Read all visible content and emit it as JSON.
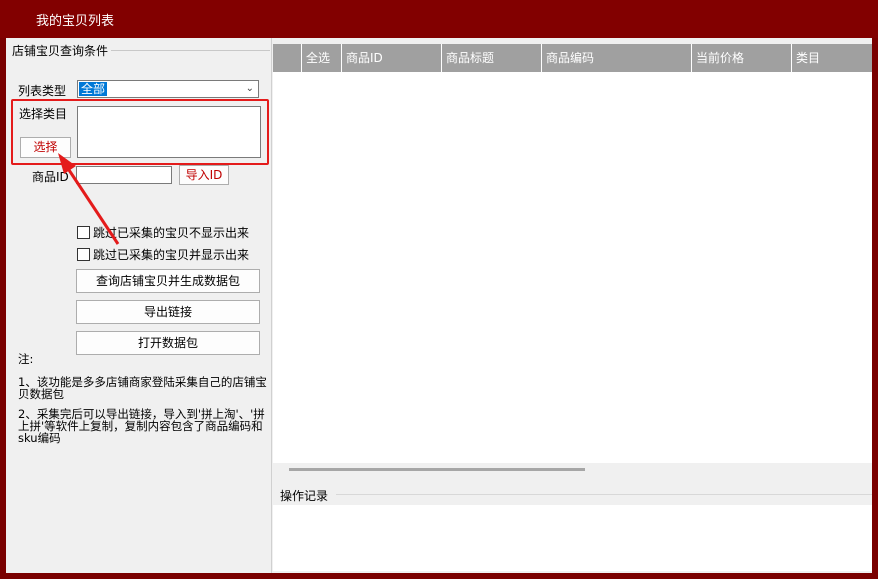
{
  "window": {
    "title": "我的宝贝列表"
  },
  "query_group": {
    "label": "店铺宝贝查询条件",
    "list_type_label": "列表类型",
    "list_type_value": "全部",
    "category_label": "选择类目",
    "select_button": "选择",
    "product_id_label": "商品ID",
    "product_id_value": "",
    "import_id_button": "导入ID",
    "skip_hide_checkbox": {
      "label": "跳过已采集的宝贝不显示出来",
      "checked": false
    },
    "skip_show_checkbox": {
      "label": "跳过已采集的宝贝并显示出来",
      "checked": false
    },
    "query_button": "查询店铺宝贝并生成数据包",
    "export_button": "导出链接",
    "open_button": "打开数据包"
  },
  "notes": {
    "title": "注:",
    "line1": "1、该功能是多多店铺商家登陆采集自己的店铺宝贝数据包",
    "line2": "2、采集完后可以导出链接，导入到'拼上淘'、'拼上拼'等软件上复制，复制内容包含了商品编码和sku编码"
  },
  "table": {
    "columns": [
      "全选",
      "商品ID",
      "商品标题",
      "商品编码",
      "当前价格",
      "类目"
    ]
  },
  "log": {
    "label": "操作记录"
  },
  "colors": {
    "titlebar": "#820000",
    "highlight": "#e41b1b",
    "header": "#a0a0a0"
  }
}
